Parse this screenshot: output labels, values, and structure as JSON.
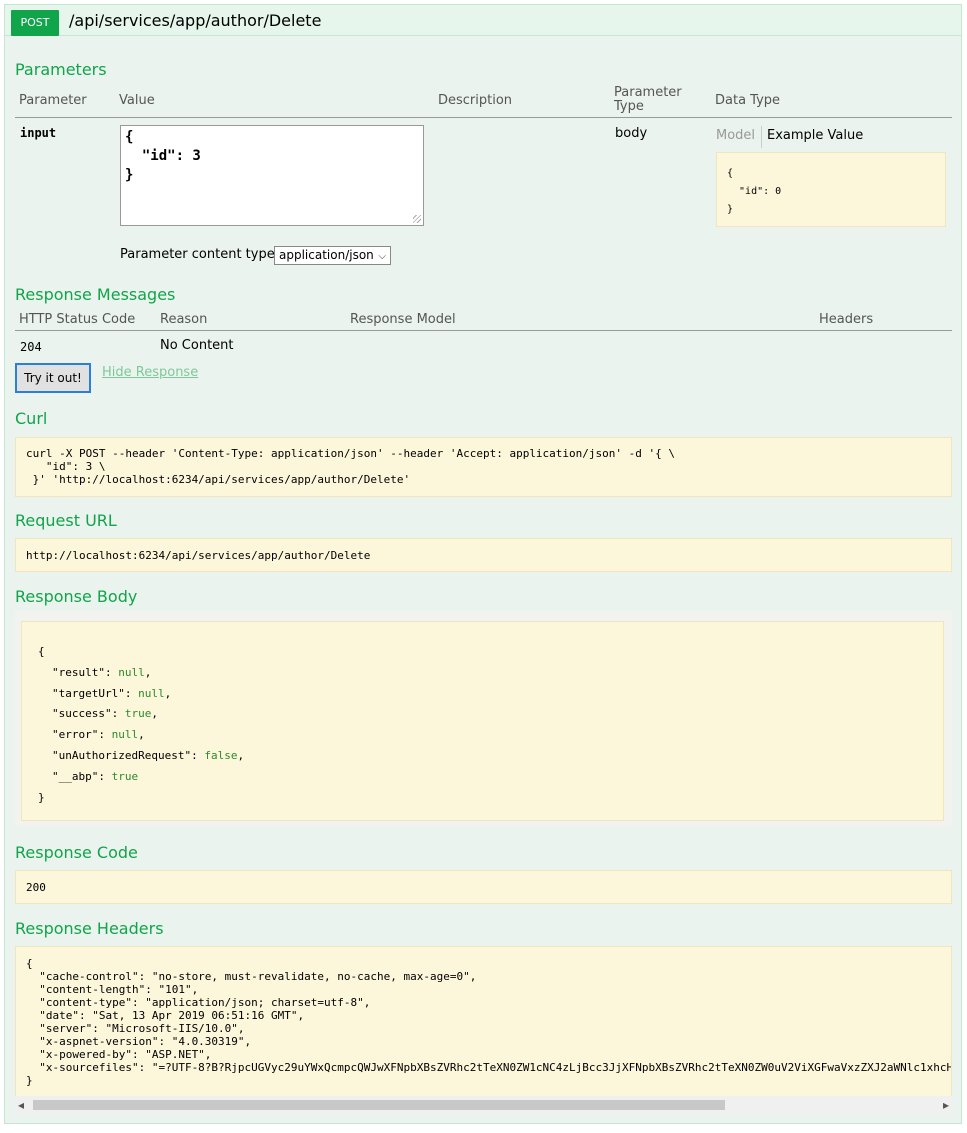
{
  "endpoint": {
    "method": "POST",
    "path": "/api/services/app/author/Delete"
  },
  "parameters": {
    "title": "Parameters",
    "headers": {
      "parameter": "Parameter",
      "value": "Value",
      "description": "Description",
      "parameter_type": "Parameter Type",
      "data_type": "Data Type"
    },
    "row": {
      "name": "input",
      "value_text": "{\n  \"id\": 3\n}",
      "type": "body",
      "model_tab": "Model",
      "example_tab": "Example Value",
      "example_json": "{\n  \"id\": 0\n}"
    },
    "content_type_label": "Parameter content type:",
    "content_type_value": "application/json"
  },
  "response_messages": {
    "title": "Response Messages",
    "headers": {
      "status_code": "HTTP Status Code",
      "reason": "Reason",
      "response_model": "Response Model",
      "headers": "Headers"
    },
    "rows": [
      {
        "code": "204",
        "reason": "No Content"
      }
    ]
  },
  "actions": {
    "try_button": "Try it out!",
    "hide_response": "Hide Response"
  },
  "curl": {
    "title": "Curl",
    "command": "curl -X POST --header 'Content-Type: application/json' --header 'Accept: application/json' -d '{ \\\n   \"id\": 3 \\\n }' 'http://localhost:6234/api/services/app/author/Delete'"
  },
  "request_url": {
    "title": "Request URL",
    "url": "http://localhost:6234/api/services/app/author/Delete"
  },
  "response_body": {
    "title": "Response Body",
    "open": "{",
    "close": "}",
    "fields": [
      {
        "key": "\"result\"",
        "value": "null",
        "comma": ","
      },
      {
        "key": "\"targetUrl\"",
        "value": "null",
        "comma": ","
      },
      {
        "key": "\"success\"",
        "value": "true",
        "comma": ","
      },
      {
        "key": "\"error\"",
        "value": "null",
        "comma": ","
      },
      {
        "key": "\"unAuthorizedRequest\"",
        "value": "false",
        "comma": ","
      },
      {
        "key": "\"__abp\"",
        "value": "true",
        "comma": ""
      }
    ]
  },
  "response_code": {
    "title": "Response Code",
    "code": "200"
  },
  "response_headers": {
    "title": "Response Headers",
    "text": "{\n  \"cache-control\": \"no-store, must-revalidate, no-cache, max-age=0\",\n  \"content-length\": \"101\",\n  \"content-type\": \"application/json; charset=utf-8\",\n  \"date\": \"Sat, 13 Apr 2019 06:51:16 GMT\",\n  \"server\": \"Microsoft-IIS/10.0\",\n  \"x-aspnet-version\": \"4.0.30319\",\n  \"x-powered-by\": \"ASP.NET\",\n  \"x-sourcefiles\": \"=?UTF-8?B?RjpcUGVyc29uYWxQcmpcQWJwXFNpbXBsZVRhc2tTeXN0ZW1cNC4zLjBcc3JjXFNpbXBsZVRhc2tTeXN0ZW0uV2ViXGFwaVxzZXJ2aWNlc1xhcHBcYXV0aG9yXERlbGV0ZQ==?=\"\n}"
  },
  "icons": {
    "scroll_left": "◂",
    "scroll_right": "▸",
    "dropdown": "⌵"
  },
  "colors": {
    "method_badge": "#10a54a",
    "section_title": "#10a54a",
    "panel_bg": "#ebf3ee",
    "code_bg": "#fcf6db",
    "json_literal": "#2b8a2b"
  }
}
